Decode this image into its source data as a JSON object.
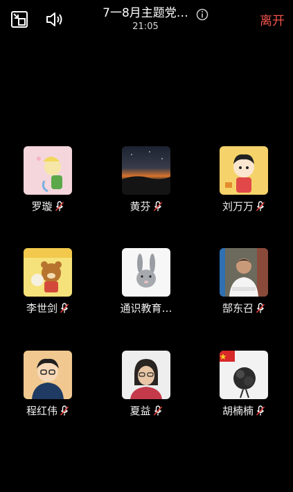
{
  "header": {
    "title": "7一8月主题党…",
    "time": "21:05",
    "leave_label": "离开",
    "leave_color": "#f0524a",
    "icons": [
      "minimize-window-icon",
      "speaker-icon",
      "info-icon"
    ]
  },
  "participants": [
    {
      "name": "罗璇",
      "avatar": "cartoon-girl-pink-background",
      "mic": "muted"
    },
    {
      "name": "黄芬",
      "avatar": "sunset-landscape",
      "mic": "muted"
    },
    {
      "name": "刘万万",
      "avatar": "cartoon-boy-yellow-background",
      "mic": "muted"
    },
    {
      "name": "李世剑",
      "avatar": "cartoon-bear-yellow-background",
      "mic": "muted"
    },
    {
      "name": "通识教育…",
      "avatar": "rabbit-drawing",
      "mic": "none"
    },
    {
      "name": "郜东召",
      "avatar": "man-photo",
      "mic": "muted"
    },
    {
      "name": "程红伟",
      "avatar": "cartoon-man-glasses",
      "mic": "muted"
    },
    {
      "name": "夏益",
      "avatar": "woman-photo",
      "mic": "muted"
    },
    {
      "name": "胡楠楠",
      "avatar": "flag-and-flowers",
      "mic": "muted"
    }
  ]
}
